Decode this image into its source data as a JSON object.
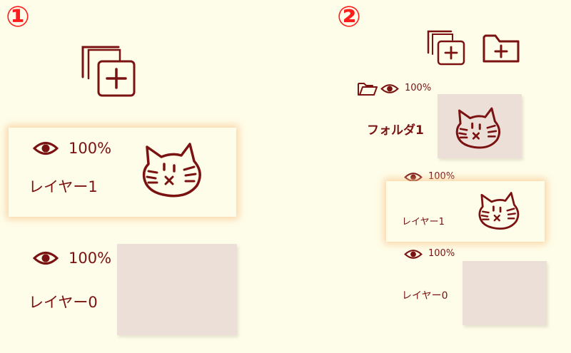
{
  "steps": {
    "one": "①",
    "two": "②"
  },
  "icons": {
    "new_layer": "new-layer-plus-icon",
    "new_folder": "new-folder-plus-icon",
    "visibility": "eye-icon",
    "folder_open": "open-folder-icon",
    "thumbnail": "cat-face-drawing"
  },
  "panel_one": {
    "layers": [
      {
        "opacity": "100%",
        "name": "レイヤー1",
        "selected": true
      },
      {
        "opacity": "100%",
        "name": "レイヤー0",
        "selected": false
      }
    ]
  },
  "panel_two": {
    "folder": {
      "opacity": "100%",
      "name": "フォルダ1"
    },
    "layers": [
      {
        "opacity": "100%",
        "name": "レイヤー1",
        "selected": true
      },
      {
        "opacity": "100%",
        "name": "レイヤー0",
        "selected": false
      }
    ]
  },
  "colors": {
    "background": "#fefde9",
    "ink": "#7a1212",
    "step_number": "#ff1c1c",
    "selection_glow": "#f8c48c",
    "empty_thumbnail": "#ecdfd7"
  }
}
